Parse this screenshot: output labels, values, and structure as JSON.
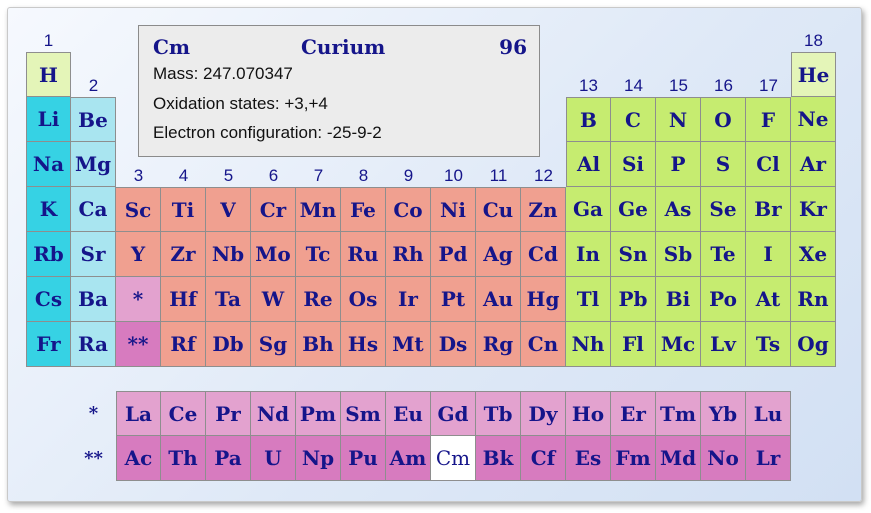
{
  "info": {
    "symbol": "Cm",
    "name": "Curium",
    "number": "96",
    "mass": "Mass: 247.070347",
    "oxidation": "Oxidation states: +3,+4",
    "config": "Electron configuration: -25-9-2"
  },
  "group_numbers": [
    "1",
    "2",
    "3",
    "4",
    "5",
    "6",
    "7",
    "8",
    "9",
    "10",
    "11",
    "12",
    "13",
    "14",
    "15",
    "16",
    "17",
    "18"
  ],
  "series_labels": [
    "*",
    "**"
  ],
  "colors": {
    "alkali": "#36d2e4",
    "alkaline_earth": "#a9e5f0",
    "transition": "#f0a090",
    "post_transition": "#c6ec70",
    "noble": "#e4f5b8",
    "lanthanide": "#e3a2cf",
    "actinide": "#d77bbf",
    "selected": "#ffffff"
  },
  "elements": [
    {
      "s": "H",
      "c": 1,
      "r": 1,
      "t": "noble"
    },
    {
      "s": "He",
      "c": 18,
      "r": 1,
      "t": "noble"
    },
    {
      "s": "Li",
      "c": 1,
      "r": 2,
      "t": "alkali"
    },
    {
      "s": "Be",
      "c": 2,
      "r": 2,
      "t": "alkaline_earth"
    },
    {
      "s": "B",
      "c": 13,
      "r": 2,
      "t": "post_transition"
    },
    {
      "s": "C",
      "c": 14,
      "r": 2,
      "t": "post_transition"
    },
    {
      "s": "N",
      "c": 15,
      "r": 2,
      "t": "post_transition"
    },
    {
      "s": "O",
      "c": 16,
      "r": 2,
      "t": "post_transition"
    },
    {
      "s": "F",
      "c": 17,
      "r": 2,
      "t": "post_transition"
    },
    {
      "s": "Ne",
      "c": 18,
      "r": 2,
      "t": "post_transition"
    },
    {
      "s": "Na",
      "c": 1,
      "r": 3,
      "t": "alkali"
    },
    {
      "s": "Mg",
      "c": 2,
      "r": 3,
      "t": "alkaline_earth"
    },
    {
      "s": "Al",
      "c": 13,
      "r": 3,
      "t": "post_transition"
    },
    {
      "s": "Si",
      "c": 14,
      "r": 3,
      "t": "post_transition"
    },
    {
      "s": "P",
      "c": 15,
      "r": 3,
      "t": "post_transition"
    },
    {
      "s": "S",
      "c": 16,
      "r": 3,
      "t": "post_transition"
    },
    {
      "s": "Cl",
      "c": 17,
      "r": 3,
      "t": "post_transition"
    },
    {
      "s": "Ar",
      "c": 18,
      "r": 3,
      "t": "post_transition"
    },
    {
      "s": "K",
      "c": 1,
      "r": 4,
      "t": "alkali"
    },
    {
      "s": "Ca",
      "c": 2,
      "r": 4,
      "t": "alkaline_earth"
    },
    {
      "s": "Sc",
      "c": 3,
      "r": 4,
      "t": "transition"
    },
    {
      "s": "Ti",
      "c": 4,
      "r": 4,
      "t": "transition"
    },
    {
      "s": "V",
      "c": 5,
      "r": 4,
      "t": "transition"
    },
    {
      "s": "Cr",
      "c": 6,
      "r": 4,
      "t": "transition"
    },
    {
      "s": "Mn",
      "c": 7,
      "r": 4,
      "t": "transition"
    },
    {
      "s": "Fe",
      "c": 8,
      "r": 4,
      "t": "transition"
    },
    {
      "s": "Co",
      "c": 9,
      "r": 4,
      "t": "transition"
    },
    {
      "s": "Ni",
      "c": 10,
      "r": 4,
      "t": "transition"
    },
    {
      "s": "Cu",
      "c": 11,
      "r": 4,
      "t": "transition"
    },
    {
      "s": "Zn",
      "c": 12,
      "r": 4,
      "t": "transition"
    },
    {
      "s": "Ga",
      "c": 13,
      "r": 4,
      "t": "post_transition"
    },
    {
      "s": "Ge",
      "c": 14,
      "r": 4,
      "t": "post_transition"
    },
    {
      "s": "As",
      "c": 15,
      "r": 4,
      "t": "post_transition"
    },
    {
      "s": "Se",
      "c": 16,
      "r": 4,
      "t": "post_transition"
    },
    {
      "s": "Br",
      "c": 17,
      "r": 4,
      "t": "post_transition"
    },
    {
      "s": "Kr",
      "c": 18,
      "r": 4,
      "t": "post_transition"
    },
    {
      "s": "Rb",
      "c": 1,
      "r": 5,
      "t": "alkali"
    },
    {
      "s": "Sr",
      "c": 2,
      "r": 5,
      "t": "alkaline_earth"
    },
    {
      "s": "Y",
      "c": 3,
      "r": 5,
      "t": "transition"
    },
    {
      "s": "Zr",
      "c": 4,
      "r": 5,
      "t": "transition"
    },
    {
      "s": "Nb",
      "c": 5,
      "r": 5,
      "t": "transition"
    },
    {
      "s": "Mo",
      "c": 6,
      "r": 5,
      "t": "transition"
    },
    {
      "s": "Tc",
      "c": 7,
      "r": 5,
      "t": "transition"
    },
    {
      "s": "Ru",
      "c": 8,
      "r": 5,
      "t": "transition"
    },
    {
      "s": "Rh",
      "c": 9,
      "r": 5,
      "t": "transition"
    },
    {
      "s": "Pd",
      "c": 10,
      "r": 5,
      "t": "transition"
    },
    {
      "s": "Ag",
      "c": 11,
      "r": 5,
      "t": "transition"
    },
    {
      "s": "Cd",
      "c": 12,
      "r": 5,
      "t": "transition"
    },
    {
      "s": "In",
      "c": 13,
      "r": 5,
      "t": "post_transition"
    },
    {
      "s": "Sn",
      "c": 14,
      "r": 5,
      "t": "post_transition"
    },
    {
      "s": "Sb",
      "c": 15,
      "r": 5,
      "t": "post_transition"
    },
    {
      "s": "Te",
      "c": 16,
      "r": 5,
      "t": "post_transition"
    },
    {
      "s": "I",
      "c": 17,
      "r": 5,
      "t": "post_transition"
    },
    {
      "s": "Xe",
      "c": 18,
      "r": 5,
      "t": "post_transition"
    },
    {
      "s": "Cs",
      "c": 1,
      "r": 6,
      "t": "alkali"
    },
    {
      "s": "Ba",
      "c": 2,
      "r": 6,
      "t": "alkaline_earth"
    },
    {
      "s": "*",
      "c": 3,
      "r": 6,
      "t": "lanthanide"
    },
    {
      "s": "Hf",
      "c": 4,
      "r": 6,
      "t": "transition"
    },
    {
      "s": "Ta",
      "c": 5,
      "r": 6,
      "t": "transition"
    },
    {
      "s": "W",
      "c": 6,
      "r": 6,
      "t": "transition"
    },
    {
      "s": "Re",
      "c": 7,
      "r": 6,
      "t": "transition"
    },
    {
      "s": "Os",
      "c": 8,
      "r": 6,
      "t": "transition"
    },
    {
      "s": "Ir",
      "c": 9,
      "r": 6,
      "t": "transition"
    },
    {
      "s": "Pt",
      "c": 10,
      "r": 6,
      "t": "transition"
    },
    {
      "s": "Au",
      "c": 11,
      "r": 6,
      "t": "transition"
    },
    {
      "s": "Hg",
      "c": 12,
      "r": 6,
      "t": "transition"
    },
    {
      "s": "Tl",
      "c": 13,
      "r": 6,
      "t": "post_transition"
    },
    {
      "s": "Pb",
      "c": 14,
      "r": 6,
      "t": "post_transition"
    },
    {
      "s": "Bi",
      "c": 15,
      "r": 6,
      "t": "post_transition"
    },
    {
      "s": "Po",
      "c": 16,
      "r": 6,
      "t": "post_transition"
    },
    {
      "s": "At",
      "c": 17,
      "r": 6,
      "t": "post_transition"
    },
    {
      "s": "Rn",
      "c": 18,
      "r": 6,
      "t": "post_transition"
    },
    {
      "s": "Fr",
      "c": 1,
      "r": 7,
      "t": "alkali"
    },
    {
      "s": "Ra",
      "c": 2,
      "r": 7,
      "t": "alkaline_earth"
    },
    {
      "s": "**",
      "c": 3,
      "r": 7,
      "t": "actinide"
    },
    {
      "s": "Rf",
      "c": 4,
      "r": 7,
      "t": "transition"
    },
    {
      "s": "Db",
      "c": 5,
      "r": 7,
      "t": "transition"
    },
    {
      "s": "Sg",
      "c": 6,
      "r": 7,
      "t": "transition"
    },
    {
      "s": "Bh",
      "c": 7,
      "r": 7,
      "t": "transition"
    },
    {
      "s": "Hs",
      "c": 8,
      "r": 7,
      "t": "transition"
    },
    {
      "s": "Mt",
      "c": 9,
      "r": 7,
      "t": "transition"
    },
    {
      "s": "Ds",
      "c": 10,
      "r": 7,
      "t": "transition"
    },
    {
      "s": "Rg",
      "c": 11,
      "r": 7,
      "t": "transition"
    },
    {
      "s": "Cn",
      "c": 12,
      "r": 7,
      "t": "transition"
    },
    {
      "s": "Nh",
      "c": 13,
      "r": 7,
      "t": "post_transition"
    },
    {
      "s": "Fl",
      "c": 14,
      "r": 7,
      "t": "post_transition"
    },
    {
      "s": "Mc",
      "c": 15,
      "r": 7,
      "t": "post_transition"
    },
    {
      "s": "Lv",
      "c": 16,
      "r": 7,
      "t": "post_transition"
    },
    {
      "s": "Ts",
      "c": 17,
      "r": 7,
      "t": "post_transition"
    },
    {
      "s": "Og",
      "c": 18,
      "r": 7,
      "t": "post_transition"
    },
    {
      "s": "La",
      "c": 3,
      "r": 9,
      "t": "lanthanide"
    },
    {
      "s": "Ce",
      "c": 4,
      "r": 9,
      "t": "lanthanide"
    },
    {
      "s": "Pr",
      "c": 5,
      "r": 9,
      "t": "lanthanide"
    },
    {
      "s": "Nd",
      "c": 6,
      "r": 9,
      "t": "lanthanide"
    },
    {
      "s": "Pm",
      "c": 7,
      "r": 9,
      "t": "lanthanide"
    },
    {
      "s": "Sm",
      "c": 8,
      "r": 9,
      "t": "lanthanide"
    },
    {
      "s": "Eu",
      "c": 9,
      "r": 9,
      "t": "lanthanide"
    },
    {
      "s": "Gd",
      "c": 10,
      "r": 9,
      "t": "lanthanide"
    },
    {
      "s": "Tb",
      "c": 11,
      "r": 9,
      "t": "lanthanide"
    },
    {
      "s": "Dy",
      "c": 12,
      "r": 9,
      "t": "lanthanide"
    },
    {
      "s": "Ho",
      "c": 13,
      "r": 9,
      "t": "lanthanide"
    },
    {
      "s": "Er",
      "c": 14,
      "r": 9,
      "t": "lanthanide"
    },
    {
      "s": "Tm",
      "c": 15,
      "r": 9,
      "t": "lanthanide"
    },
    {
      "s": "Yb",
      "c": 16,
      "r": 9,
      "t": "lanthanide"
    },
    {
      "s": "Lu",
      "c": 17,
      "r": 9,
      "t": "lanthanide"
    },
    {
      "s": "Ac",
      "c": 3,
      "r": 10,
      "t": "actinide"
    },
    {
      "s": "Th",
      "c": 4,
      "r": 10,
      "t": "actinide"
    },
    {
      "s": "Pa",
      "c": 5,
      "r": 10,
      "t": "actinide"
    },
    {
      "s": "U",
      "c": 6,
      "r": 10,
      "t": "actinide"
    },
    {
      "s": "Np",
      "c": 7,
      "r": 10,
      "t": "actinide"
    },
    {
      "s": "Pu",
      "c": 8,
      "r": 10,
      "t": "actinide"
    },
    {
      "s": "Am",
      "c": 9,
      "r": 10,
      "t": "actinide"
    },
    {
      "s": "Cm",
      "c": 10,
      "r": 10,
      "t": "actinide",
      "selected": true
    },
    {
      "s": "Bk",
      "c": 11,
      "r": 10,
      "t": "actinide"
    },
    {
      "s": "Cf",
      "c": 12,
      "r": 10,
      "t": "actinide"
    },
    {
      "s": "Es",
      "c": 13,
      "r": 10,
      "t": "actinide"
    },
    {
      "s": "Fm",
      "c": 14,
      "r": 10,
      "t": "actinide"
    },
    {
      "s": "Md",
      "c": 15,
      "r": 10,
      "t": "actinide"
    },
    {
      "s": "No",
      "c": 16,
      "r": 10,
      "t": "actinide"
    },
    {
      "s": "Lr",
      "c": 17,
      "r": 10,
      "t": "actinide"
    }
  ]
}
